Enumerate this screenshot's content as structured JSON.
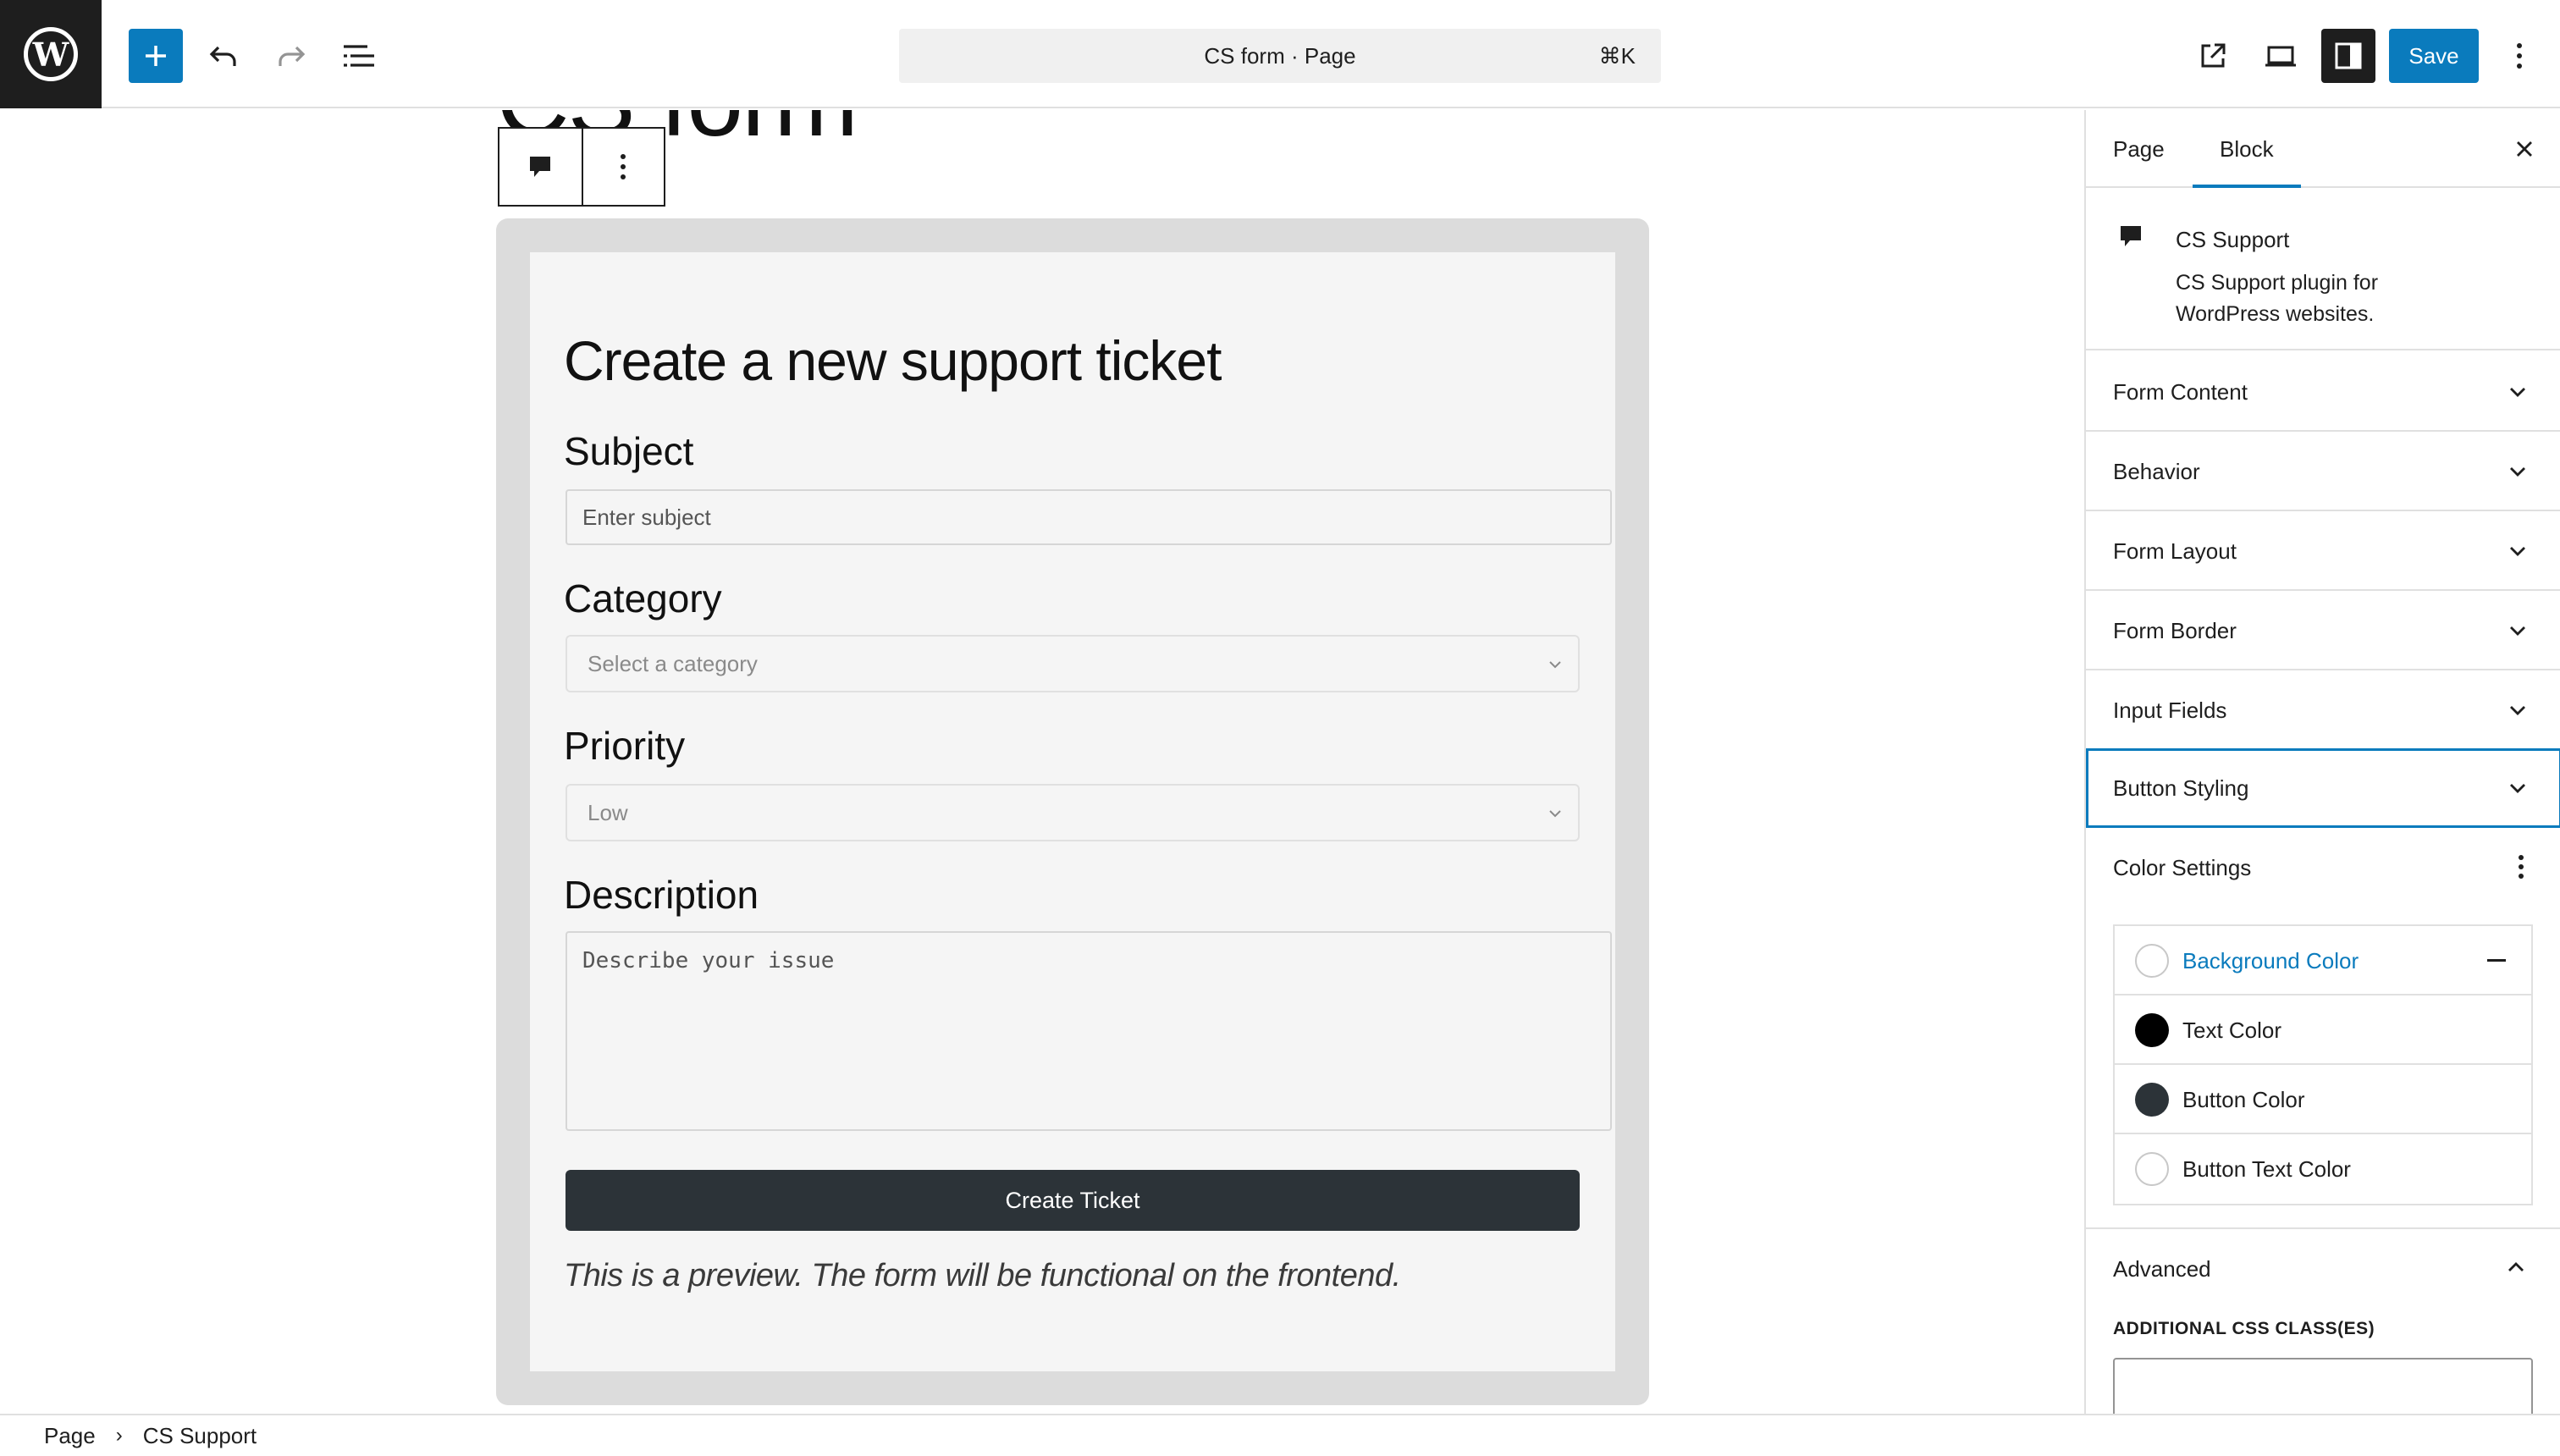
{
  "header": {
    "logo_text": "W",
    "document_title": "CS form · Page",
    "shortcut": "⌘K",
    "save_label": "Save",
    "icons": [
      "wordpress-logo-icon",
      "plus-icon",
      "undo-icon",
      "redo-icon",
      "document-overview-icon",
      "external-preview-icon",
      "device-preview-icon",
      "settings-sidebar-icon",
      "options-icon"
    ]
  },
  "canvas": {
    "page_title": "CS form",
    "block_toolbar": {
      "icons": [
        "cs-support-block-icon",
        "block-options-icon"
      ]
    },
    "form": {
      "heading": "Create a new support ticket",
      "subject_label": "Subject",
      "subject_placeholder": "Enter subject",
      "category_label": "Category",
      "category_value": "Select a category",
      "priority_label": "Priority",
      "priority_value": "Low",
      "description_label": "Description",
      "description_placeholder": "Describe your issue",
      "submit_label": "Create Ticket",
      "preview_note": "This is a preview. The form will be functional on the frontend."
    }
  },
  "sidebar": {
    "tabs": [
      {
        "label": "Page",
        "active": false
      },
      {
        "label": "Block",
        "active": true
      }
    ],
    "block_name": "CS Support",
    "block_description": "CS Support plugin for WordPress websites.",
    "panels": [
      {
        "label": "Form Content",
        "expanded": false
      },
      {
        "label": "Behavior",
        "expanded": false
      },
      {
        "label": "Form Layout",
        "expanded": false
      },
      {
        "label": "Form Border",
        "expanded": false
      },
      {
        "label": "Input Fields",
        "expanded": false
      },
      {
        "label": "Button Styling",
        "expanded": false,
        "focused": true
      }
    ],
    "color_settings": {
      "title": "Color Settings",
      "items": [
        {
          "label": "Background Color",
          "color": "",
          "active": true
        },
        {
          "label": "Text Color",
          "color": "#000000"
        },
        {
          "label": "Button Color",
          "color": "#2c3338"
        },
        {
          "label": "Button Text Color",
          "color": ""
        }
      ]
    },
    "advanced": {
      "title": "Advanced",
      "css_class_label": "ADDITIONAL CSS CLASS(ES)",
      "css_class_value": ""
    }
  },
  "footer": {
    "breadcrumb": [
      "Page",
      "CS Support"
    ]
  },
  "colors": {
    "accent": "#0a7bbd",
    "dark": "#1e1e1e",
    "button": "#2c3338"
  }
}
